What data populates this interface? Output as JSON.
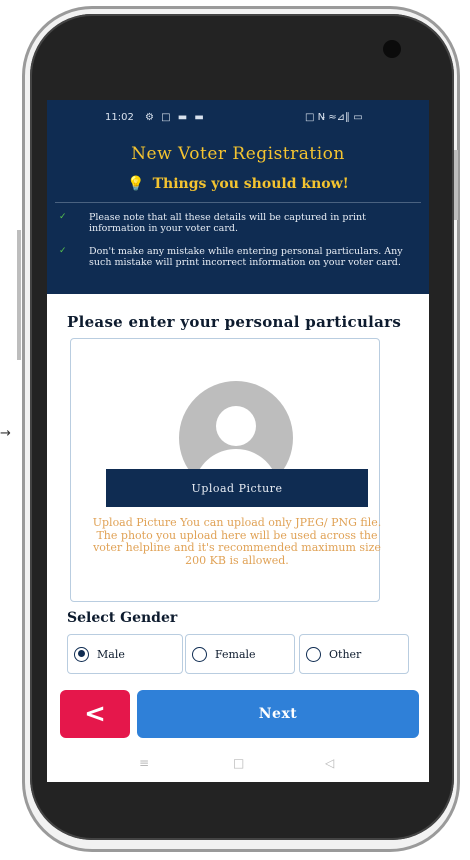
{
  "status_bar": {
    "time": "11:02",
    "left_icons": "⚙ □ ▬ ▬",
    "right_icons": "□ N̵ ≈⊿∥ ▭"
  },
  "header": {
    "title": "New Voter Registration",
    "hint_title": "Things you should know!",
    "hint_icon": "lightbulb-icon",
    "bullets": [
      "Please note that all these details will be captured in print information in your voter card.",
      "Don't make any mistake while entering personal particulars. Any such mistake will print incorrect information on your voter card."
    ]
  },
  "form": {
    "section_title": "Please enter your personal particulars",
    "upload_button_label": "Upload Picture",
    "upload_note": "Upload Picture You can upload only JPEG/ PNG file. The photo you upload here will be used across the voter helpline and it's recommended maximum size 200 KB is allowed.",
    "gender_label": "Select Gender",
    "gender_options": [
      {
        "label": "Male",
        "selected": true
      },
      {
        "label": "Female",
        "selected": false
      },
      {
        "label": "Other",
        "selected": false
      }
    ]
  },
  "actions": {
    "back_symbol": "<",
    "next_label": "Next"
  },
  "nav_bar": {
    "menu_glyph": "≡",
    "home_glyph": "□",
    "back_glyph": "◁"
  },
  "colors": {
    "header_bg": "#0f2c52",
    "accent_yellow": "#f4c430",
    "back_button": "#e5174b",
    "next_button": "#2f80d8",
    "note_text": "#e0a256"
  }
}
